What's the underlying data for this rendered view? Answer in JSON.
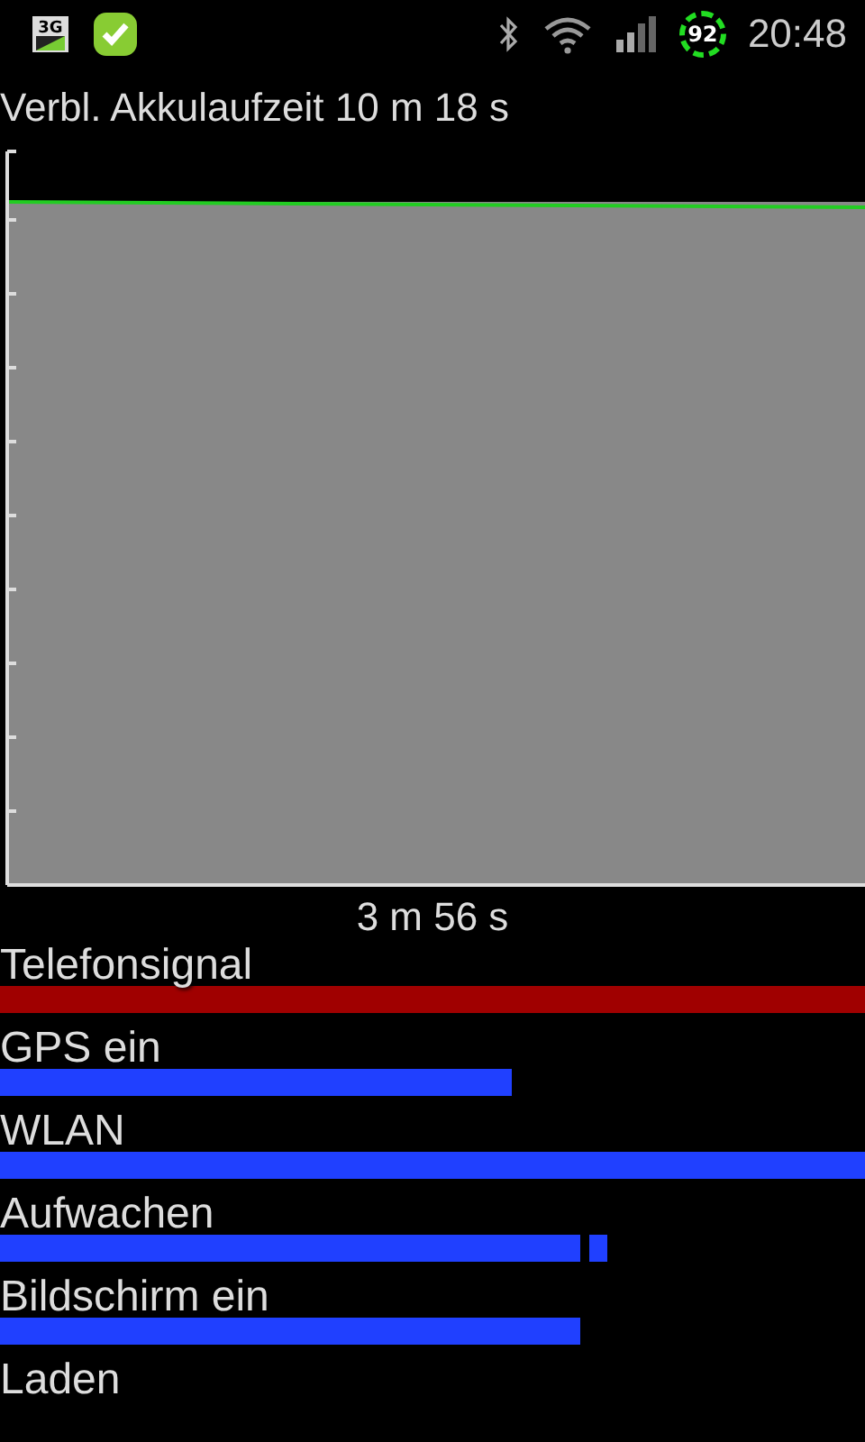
{
  "status_bar": {
    "network": "3G",
    "battery": "92",
    "time": "20:48"
  },
  "title": "Verbl. Akkulaufzeit 10 m 18 s",
  "chart_caption": "3 m 56 s",
  "rows": [
    {
      "label": "Telefonsignal",
      "color": "#a00000"
    },
    {
      "label": "GPS ein",
      "color": "#2040ff"
    },
    {
      "label": "WLAN",
      "color": "#2040ff"
    },
    {
      "label": "Aufwachen",
      "color": "#2040ff"
    },
    {
      "label": "Bildschirm ein",
      "color": "#2040ff"
    },
    {
      "label": "Laden"
    }
  ]
}
